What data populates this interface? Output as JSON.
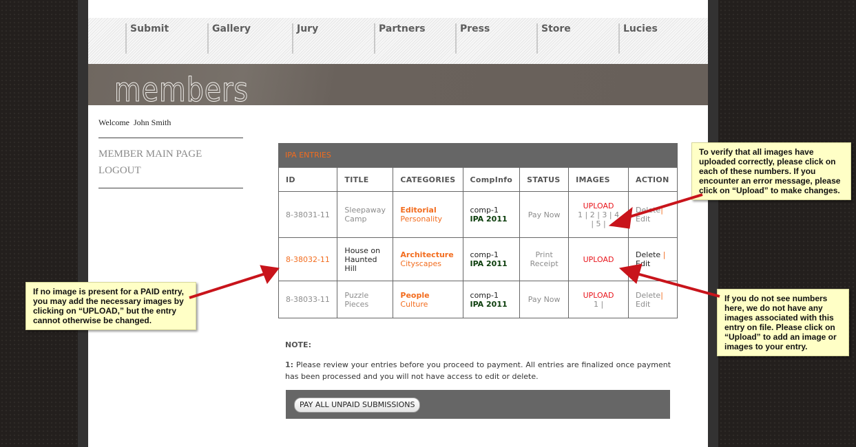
{
  "nav": {
    "items": [
      "Submit",
      "Gallery",
      "Jury",
      "Partners",
      "Press",
      "Store",
      "Lucies"
    ]
  },
  "banner": {
    "title": "members"
  },
  "sidebar": {
    "welcome_label": "Welcome",
    "user_name": "John Smith",
    "links": [
      "MEMBER MAIN PAGE",
      "LOGOUT"
    ]
  },
  "entries": {
    "heading": "IPA ENTRIES",
    "columns": [
      "ID",
      "TITLE",
      "CATEGORIES",
      "CompInfo",
      "STATUS",
      "IMAGES",
      "ACTION"
    ],
    "rows": [
      {
        "id": "8-38031-11",
        "title_line1": "Sleepaway",
        "title_line2": "Camp",
        "category": "Editorial",
        "subcategory": "Personality",
        "comp": "comp-1",
        "comp_name": "IPA 2011",
        "status": "Pay Now",
        "upload": "UPLOAD",
        "images": "1 | 2 | 3 | 4 | 5 |",
        "delete": "Delete",
        "edit": "Edit"
      },
      {
        "id": "8-38032-11",
        "title_line1": "House on",
        "title_line2": "Haunted",
        "title_line3": "Hill",
        "category": "Architecture",
        "subcategory": "Cityscapes",
        "comp": "comp-1",
        "comp_name": "IPA 2011",
        "status_line1": "Print",
        "status_line2": "Receipt",
        "upload": "UPLOAD",
        "images": "",
        "delete": "Delete",
        "edit": "Edit"
      },
      {
        "id": "8-38033-11",
        "title_line1": "Puzzle",
        "title_line2": "Pieces",
        "category": "People",
        "subcategory": "Culture",
        "comp": "comp-1",
        "comp_name": "IPA 2011",
        "status": "Pay Now",
        "upload": "UPLOAD",
        "images": "1 |",
        "delete": "Delete",
        "edit": "Edit"
      }
    ],
    "separator": "|"
  },
  "note": {
    "title": "NOTE:",
    "number": "1:",
    "text": "Please review your entries before you proceed to payment. All entries are finalized once payment has been processed and you will not have access to edit or delete."
  },
  "pay_button": "PAY ALL UNPAID SUBMISSIONS",
  "callouts": {
    "top_right": "To verify that all images have uploaded correctly, please click on each of these numbers.  If you encounter an error message, please click on “Upload” to make changes.",
    "bottom_right": "If you do not see numbers here, we do not have any images associated with this entry on file.  Please click on “Upload” to add an image or images to your entry.",
    "left": "If no image is present for a PAID entry, you may add the necessary images by clicking on “UPLOAD,” but the entry cannot otherwise be changed."
  },
  "colors": {
    "accent_orange": "#f26c1e",
    "upload_red": "#e8141b",
    "comp_green": "#0b3d0b",
    "callout_bg": "#ffffc6",
    "arrow_red": "#c8141b"
  }
}
